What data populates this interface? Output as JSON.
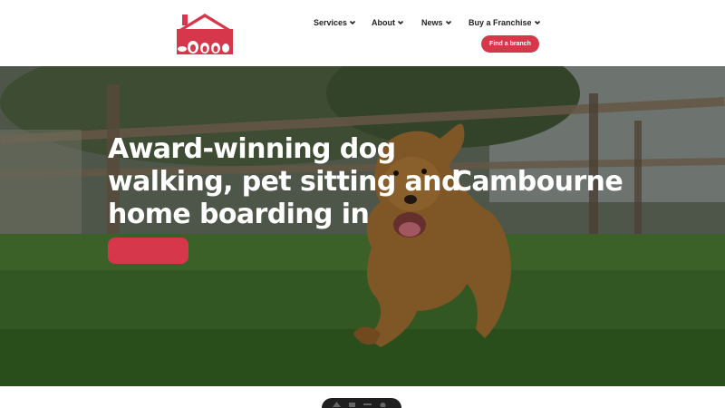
{
  "brand": {
    "logo_icon": "house-paws-logo",
    "accent_color": "#d6374a"
  },
  "nav": {
    "items": [
      {
        "label": "Services"
      },
      {
        "label": "About"
      },
      {
        "label": "News"
      },
      {
        "label": "Buy a Franchise"
      }
    ],
    "cta_label": "Find a branch"
  },
  "hero": {
    "title_lines": [
      "Award-winning dog",
      "walking, pet sitting and",
      "home boarding in"
    ],
    "location": "Cambourne",
    "cta_label": ""
  }
}
